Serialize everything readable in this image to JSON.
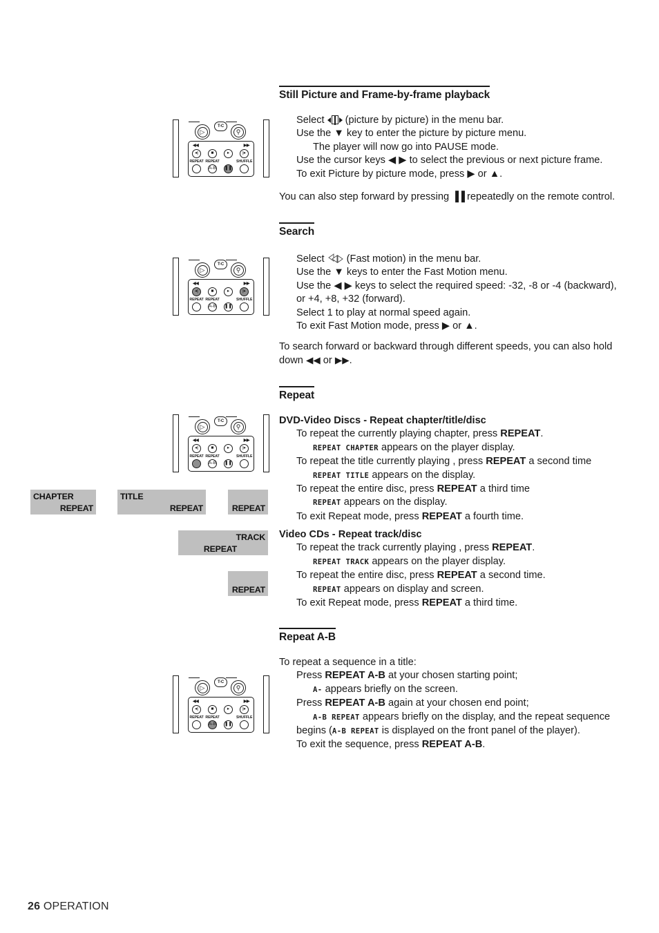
{
  "page": {
    "footer_number": "26",
    "footer_label": "OPERATION"
  },
  "sections": {
    "still_picture": {
      "heading": "Still Picture and Frame-by-frame playback",
      "lines": {
        "l1_pre": "Select ",
        "l1_post": " (picture by picture) in the menu bar.",
        "l2": "Use the ▼ key to enter the picture by picture menu.",
        "l3": "The player will now go into PAUSE mode.",
        "l4": "Use the cursor keys ◀ ▶ to select the previous or next picture frame.",
        "l5": "To exit Picture by picture mode, press ▶ or ▲.",
        "note_pre": "You can also step forward by pressing ",
        "note_icon": "▐▐",
        "note_post": " repeatedly on the remote control."
      }
    },
    "search": {
      "heading": "Search",
      "lines": {
        "l1_pre": "Select ",
        "l1_post": " (Fast motion) in the menu bar.",
        "l2": "Use the ▼ keys to enter the Fast Motion menu.",
        "l3": "Use the ◀ ▶ keys to select the required speed: -32, -8 or -4 (backward), or +4, +8, +32 (forward).",
        "l4": "Select 1 to play at normal speed again.",
        "l5": "To exit Fast Motion mode, press ▶ or ▲.",
        "note_pre": "To search forward or backward through different speeds, you can also hold down ",
        "note_icon_a": "◀◀",
        "note_mid": " or ",
        "note_icon_b": "▶▶",
        "note_post": "."
      }
    },
    "repeat": {
      "heading": "Repeat",
      "dvd": {
        "subhead": "DVD-Video Discs - Repeat chapter/title/disc",
        "l1_pre": "To repeat the currently playing chapter, press ",
        "l1_b": "REPEAT",
        "l1_post": ".",
        "l2_disp": "REPEAT CHAPTER",
        "l2_post": " appears on the player display.",
        "l3_pre": "To repeat the title currently playing , press ",
        "l3_b": "REPEAT",
        "l3_post": " a second time",
        "l4_disp": "REPEAT TITLE",
        "l4_post": " appears on the display.",
        "l5_pre": "To repeat the entire disc, press ",
        "l5_b": "REPEAT",
        "l5_post": " a third time",
        "l6_disp": "REPEAT",
        "l6_post": " appears on the display.",
        "l7_pre": "To exit Repeat mode, press ",
        "l7_b": "REPEAT",
        "l7_post": " a fourth time."
      },
      "vcd": {
        "subhead": "Video CDs - Repeat track/disc",
        "l1_pre": "To repeat the track currently playing , press ",
        "l1_b": "REPEAT",
        "l1_post": ".",
        "l2_disp": "REPEAT TRACK",
        "l2_post": " appears on the player display.",
        "l3_pre": "To repeat the entire disc, press ",
        "l3_b": "REPEAT",
        "l3_post": " a second time.",
        "l4_disp": "REPEAT",
        "l4_post": " appears on display and screen.",
        "l5_pre": "To exit Repeat mode, press ",
        "l5_b": "REPEAT",
        "l5_post": " a third time."
      }
    },
    "repeat_ab": {
      "heading": "Repeat A-B",
      "lines": {
        "l1": "To repeat a sequence in a title:",
        "l2_pre": "Press ",
        "l2_b": "REPEAT A-B",
        "l2_post": " at your chosen starting point;",
        "l3_disp": "A-",
        "l3_post": " appears briefly on the screen.",
        "l4_pre": "Press ",
        "l4_b": "REPEAT A-B",
        "l4_post": " again at your chosen end point;",
        "l5_disp": "A-B REPEAT",
        "l5_post": " appears briefly on the display, and the repeat sequence",
        "l6_pre": "begins (",
        "l6_disp": "A-B REPEAT",
        "l6_post": " is displayed on the front panel of the player).",
        "l7_pre": "To exit the sequence, press ",
        "l7_b": "REPEAT A-B",
        "l7_post": "."
      }
    }
  },
  "display_panels": [
    {
      "name": "chapter-repeat-display",
      "top_text": "CHAPTER",
      "bottom_text": "REPEAT"
    },
    {
      "name": "title-repeat-display",
      "top_text": "TITLE",
      "bottom_text": "REPEAT"
    },
    {
      "name": "repeat-display",
      "top_text": "",
      "bottom_text": "REPEAT"
    },
    {
      "name": "track-repeat-display",
      "top_text": "TRACK",
      "bottom_text": "REPEAT"
    },
    {
      "name": "repeat-disc-display",
      "top_text": "",
      "bottom_text": "REPEAT"
    }
  ],
  "remote": {
    "tc_label": "T-C",
    "cue_back": "◀◀",
    "cue_fwd": "▶▶",
    "row1": [
      {
        "name": "previous-button",
        "glyph": "❙◀"
      },
      {
        "name": "stop-button",
        "glyph": "■"
      },
      {
        "name": "play-button",
        "glyph": "▶"
      },
      {
        "name": "next-button",
        "glyph": "▶❙"
      }
    ],
    "row2_labels": {
      "repeat": "REPEAT",
      "repeat_ab": "REPEAT",
      "shuffle": "SHUFFLE"
    },
    "row2": [
      {
        "name": "repeat-button",
        "glyph": ""
      },
      {
        "name": "repeat-ab-button",
        "glyph": "A-B"
      },
      {
        "name": "pause-button",
        "glyph": "❙❙"
      },
      {
        "name": "shuffle-button",
        "glyph": ""
      }
    ],
    "highlight": {
      "still_picture": "pause-button",
      "search": "prev-next",
      "repeat": "repeat-button",
      "repeat_ab": "repeat-ab-button"
    }
  },
  "colors": {
    "panel_grey": "#bfbfbf",
    "button_highlight": "#8e8e8e",
    "ink": "#1a1a1a"
  }
}
